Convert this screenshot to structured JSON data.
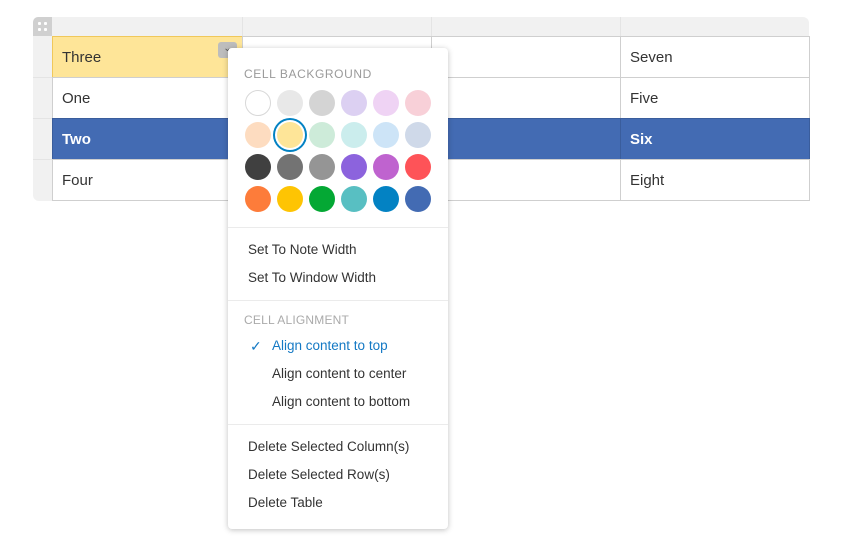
{
  "table": {
    "rows": [
      [
        "Three",
        "",
        "",
        "Seven"
      ],
      [
        "One",
        "",
        "",
        "Five"
      ],
      [
        "Two",
        "",
        "",
        "Six"
      ],
      [
        "Four",
        "",
        "",
        "Eight"
      ]
    ],
    "selected_row": 2,
    "highlighted_cell": [
      0,
      0
    ]
  },
  "menu": {
    "background_title": "CELL BACKGROUND",
    "swatches": [
      [
        "#ffffff",
        "#e8e8e8",
        "#d4d4d4",
        "#dcd0f2",
        "#efd3f4",
        "#f8d0d8"
      ],
      [
        "#fddcc0",
        "#fee598",
        "#cdebd9",
        "#cbeded",
        "#cde4f7",
        "#cfd9e9"
      ],
      [
        "#404040",
        "#737373",
        "#959595",
        "#8c63dd",
        "#bf63cf",
        "#fe5358"
      ],
      [
        "#fd7c3a",
        "#fec403",
        "#04a834",
        "#58bfc2",
        "#0382c3",
        "#436bb3"
      ]
    ],
    "selected_swatch": "#fee598",
    "width_items": [
      "Set To Note Width",
      "Set To Window Width"
    ],
    "alignment_title": "CELL ALIGNMENT",
    "alignment_items": [
      "Align content to top",
      "Align content to center",
      "Align content to bottom"
    ],
    "alignment_selected": 0,
    "delete_items": [
      "Delete Selected Column(s)",
      "Delete Selected Row(s)",
      "Delete Table"
    ]
  }
}
